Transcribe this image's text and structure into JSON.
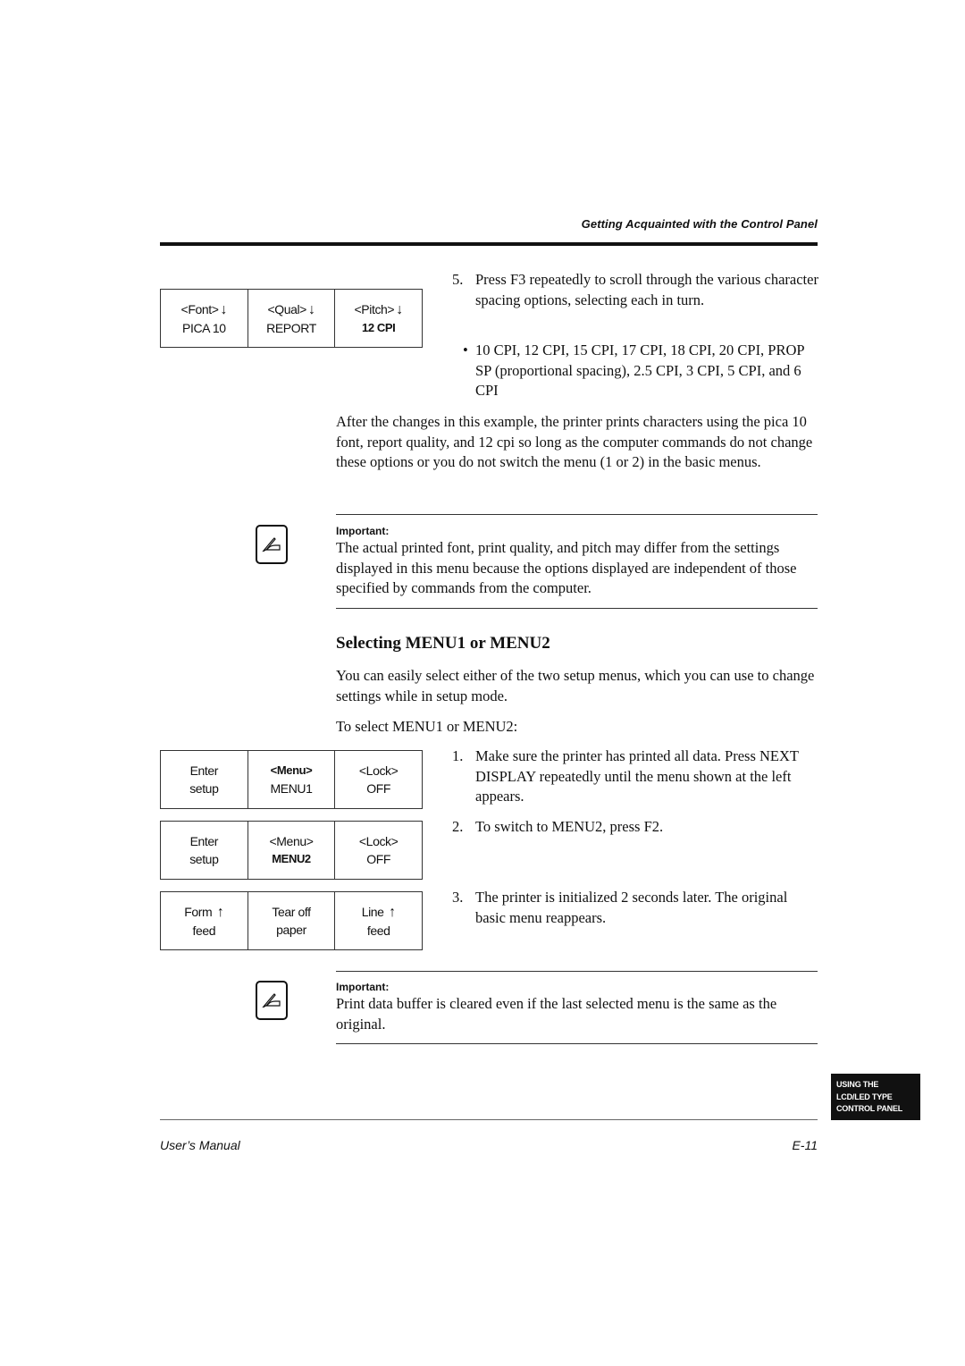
{
  "header": {
    "title": "Getting Acquainted with the Control Panel"
  },
  "lcd_pitch": {
    "cells": [
      {
        "top": "<Font>",
        "arrow": "↓",
        "bottom": "PICA 10",
        "bold_bottom": false
      },
      {
        "top": "<Qual>",
        "arrow": "↓",
        "bottom": "REPORT",
        "bold_bottom": false
      },
      {
        "top": "<Pitch>",
        "arrow": "↓",
        "bottom": "12 CPI",
        "bold_bottom": true
      }
    ]
  },
  "step5": {
    "number": "5.",
    "text": "Press F3 repeatedly to scroll through the various character spacing options, selecting each in turn.",
    "bullet": "•",
    "bullet_text": "10 CPI, 12 CPI, 15 CPI, 17 CPI, 18 CPI, 20 CPI, PROP SP (proportional spacing), 2.5 CPI, 3 CPI, 5 CPI, and 6 CPI"
  },
  "after_paragraph": "After the changes in this example, the printer prints characters using the pica 10 font, report quality, and 12 cpi so long as the computer commands do not change these options or you do not switch the menu (1 or 2) in the basic menus.",
  "note1": {
    "icon": "writing-hand-icon",
    "label": "Important:",
    "text": "The actual printed font, print quality, and pitch may differ from the settings displayed in this menu because the options displayed are independent of those specified by commands from the computer."
  },
  "section": {
    "heading": "Selecting MENU1 or MENU2",
    "intro": "You can easily select either of the two setup menus, which you can use to change settings while in setup mode.",
    "lead": "To select MENU1 or MENU2:"
  },
  "lcd_menu1": {
    "cells": [
      {
        "top": "Enter",
        "bottom": "setup"
      },
      {
        "top": "<Menu>",
        "bottom": "MENU1"
      },
      {
        "top": "<Lock>",
        "bottom": "OFF"
      }
    ]
  },
  "lcd_menu2": {
    "cells": [
      {
        "top": "Enter",
        "bottom": "setup"
      },
      {
        "top": "<Menu>",
        "bottom": "MENU2"
      },
      {
        "top": "<Lock>",
        "bottom": "OFF"
      }
    ]
  },
  "lcd_basic": {
    "cells": [
      {
        "top": "Form",
        "arrow": "↑",
        "bottom": "feed"
      },
      {
        "top": "Tear off",
        "bottom": "paper"
      },
      {
        "top": "Line",
        "arrow": "↑",
        "bottom": "feed"
      }
    ]
  },
  "steps": [
    {
      "number": "1.",
      "text": "Make sure the printer has printed all data. Press NEXT DISPLAY repeatedly until the menu shown at the left appears."
    },
    {
      "number": "2.",
      "text": "To switch to MENU2, press F2."
    },
    {
      "number": "3.",
      "text": "The printer is initialized 2 seconds later. The original basic menu reappears."
    }
  ],
  "note2": {
    "icon": "writing-hand-icon",
    "label": "Important:",
    "text": "Print data buffer is cleared even if the last selected menu is the same as the original."
  },
  "side_tab": {
    "lines": [
      "USING THE",
      "LCD/LED TYPE",
      "CONTROL PANEL"
    ]
  },
  "footer": {
    "left": "User’s Manual",
    "right": "E-11"
  }
}
